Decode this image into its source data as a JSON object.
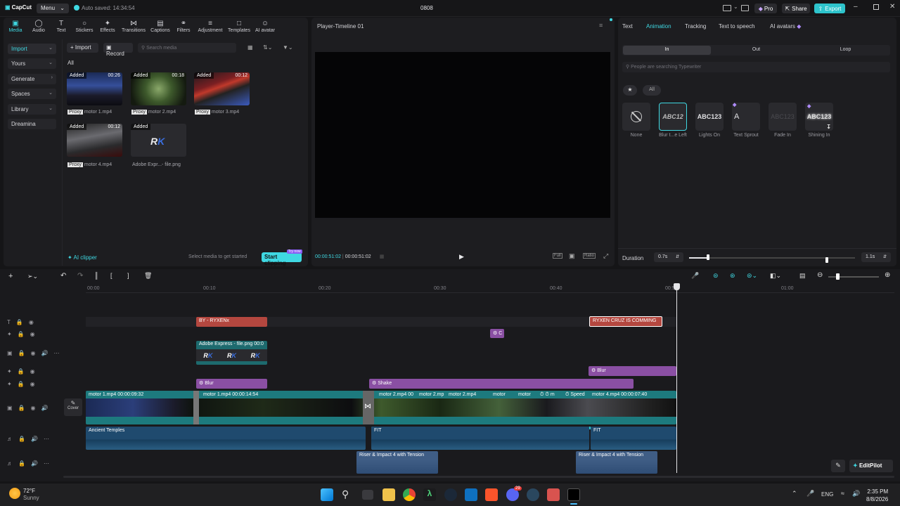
{
  "app": {
    "logo": "CapCut",
    "menu": "Menu",
    "autosave": "Auto saved: 14:34:54",
    "project": "0808",
    "pro": "Pro",
    "share": "Share",
    "export": "Export"
  },
  "toolbar": {
    "tabs": [
      "Media",
      "Audio",
      "Text",
      "Stickers",
      "Effects",
      "Transitions",
      "Captions",
      "Filters",
      "Adjustment",
      "Templates",
      "AI avatar"
    ]
  },
  "sidebar": {
    "items": [
      "Import",
      "Yours",
      "Generate",
      "Spaces",
      "Library",
      "Dreamina"
    ]
  },
  "media": {
    "import": "Import",
    "record": "Record",
    "search_placeholder": "Search media",
    "filter_all": "All",
    "items": [
      {
        "added": "Added",
        "dur": "00:26",
        "proxy": "Proxy",
        "name": "motor 1.mp4"
      },
      {
        "added": "Added",
        "dur": "00:18",
        "proxy": "Proxy",
        "name": "motor 2.mp4"
      },
      {
        "added": "Added",
        "dur": "00:12",
        "proxy": "Proxy",
        "name": "motor 3.mp4"
      },
      {
        "added": "Added",
        "dur": "00:12",
        "proxy": "Proxy",
        "name": "motor 4.mp4"
      },
      {
        "added": "Added",
        "dur": "",
        "proxy": "",
        "name": "Adobe Expr...- file.png"
      }
    ],
    "ai_clipper": "AI clipper",
    "hint": "Select media to get started",
    "start_clipping": "Start clipping",
    "try_now": "Try now"
  },
  "player": {
    "title": "Player-Timeline 01",
    "current": "00:00:51:02",
    "total": "00:00:51:02",
    "full": "Full",
    "ratio": "Ratio"
  },
  "inspector": {
    "tabs": [
      "Text",
      "Animation",
      "Tracking",
      "Text to speech",
      "AI avatars"
    ],
    "subtabs": [
      "In",
      "Out",
      "Loop"
    ],
    "search_placeholder": "People are searching Typewriter",
    "filter_all": "All",
    "presets": [
      {
        "preview": "",
        "label": "None"
      },
      {
        "preview": "ABC12",
        "label": "Blur t...e Left"
      },
      {
        "preview": "ABC123",
        "label": "Lights On"
      },
      {
        "preview": "A",
        "label": "Text Sprout"
      },
      {
        "preview": "ABC123",
        "label": "Fade In"
      },
      {
        "preview": "ABC123",
        "label": "Shining In"
      }
    ],
    "duration_label": "Duration",
    "duration_value": "0.7s",
    "duration_max": "1.1s",
    "duration_fraction": 0.12
  },
  "timeline": {
    "ruler": [
      "00:00",
      "00:10",
      "00:20",
      "00:30",
      "00:40",
      "00:50",
      "01:00"
    ],
    "cover": "Cover",
    "clips": {
      "title1": "BY - RYXENx",
      "title2": "RYXEN CRUZ IS COMMING",
      "fx_small": "C",
      "png": "Adobe Express - file.png",
      "png_dur": "00:0",
      "rk": "R",
      "blur1": "Blur",
      "blur2": "Blur",
      "shake": "Shake",
      "v1": "motor 1.mp4   00:00:09:32",
      "v2": "motor 1.mp4   00:00:14:54",
      "v3": "motor 2.mp4",
      "v3b": "00",
      "v4": "motor 2.mp",
      "v5": "motor 2.mp4",
      "v6": "motor",
      "v7": "motor",
      "v8": "m",
      "v9": "Speed",
      "v10": "motor 4.mp4   00:00:07:40",
      "audio1": "Ancient Temples",
      "fit1": "FIT",
      "fit2": "FIT",
      "sfx1": "Riser & Impact 4 with Tension",
      "sfx2": "Riser & Impact 4 with Tension"
    },
    "editpilot": "EditPilot"
  },
  "taskbar": {
    "temp": "72°F",
    "weather": "Sunny",
    "lang": "ENG",
    "time": "2:35 PM",
    "date": "8/8/2026",
    "badge": "29"
  },
  "colors": {
    "accent": "#3fd8e2",
    "video": "#1d7a7e",
    "text_clip": "#b4473f",
    "effect": "#8a4fa3",
    "audio": "#1f4a6e"
  }
}
